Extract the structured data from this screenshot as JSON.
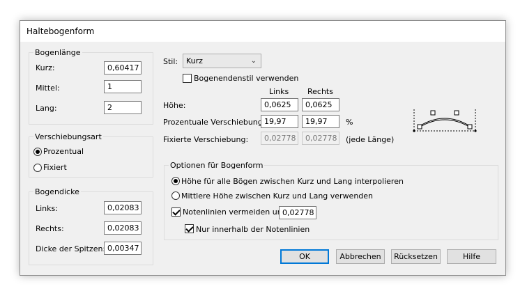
{
  "window": {
    "title": "Haltebogenform"
  },
  "bogenlaenge": {
    "legend": "Bogenlänge",
    "kurz_label": "Kurz:",
    "kurz_value": "0,60417",
    "mittel_label": "Mittel:",
    "mittel_value": "1",
    "lang_label": "Lang:",
    "lang_value": "2"
  },
  "verschiebungsart": {
    "legend": "Verschiebungsart",
    "prozentual_label": "Prozentual",
    "fixiert_label": "Fixiert",
    "selected": "Prozentual"
  },
  "bogendicke": {
    "legend": "Bogendicke",
    "links_label": "Links:",
    "links_value": "0,02083",
    "rechts_label": "Rechts:",
    "rechts_value": "0,02083",
    "spitzen_label": "Dicke der Spitzen:",
    "spitzen_value": "0,00347"
  },
  "stil": {
    "label": "Stil:",
    "value": "Kurz",
    "bogenendenstil_label": "Bogenendenstil verwenden",
    "bogenendenstil_checked": false
  },
  "grid": {
    "col_links": "Links",
    "col_rechts": "Rechts",
    "hoehe_label": "Höhe:",
    "hoehe_links": "0,0625",
    "hoehe_rechts": "0,0625",
    "prozent_label": "Prozentuale Verschiebung:",
    "prozent_links": "19,97",
    "prozent_rechts": "19,97",
    "prozent_unit": "%",
    "fixiert_label": "Fixierte Verschiebung:",
    "fixiert_links": "0,02778",
    "fixiert_rechts": "0,02778",
    "fixiert_unit": "(jede Länge)"
  },
  "optionen": {
    "legend": "Optionen für Bogenform",
    "radio_interpolieren": "Höhe für alle Bögen zwischen Kurz und Lang interpolieren",
    "radio_mittlere": "Mittlere Höhe zwischen Kurz und Lang verwenden",
    "selected": "interpolieren",
    "notenlinien_label": "Notenlinien vermeiden um:",
    "notenlinien_checked": true,
    "notenlinien_value": "0,02778",
    "innerhalb_label": "Nur innerhalb der Notenlinien",
    "innerhalb_checked": true
  },
  "buttons": {
    "ok": "OK",
    "cancel": "Abbrechen",
    "reset": "Rücksetzen",
    "help": "Hilfe"
  },
  "colors": {
    "default_button_border": "#0078d7",
    "dialog_bg": "#f0f0f0"
  }
}
